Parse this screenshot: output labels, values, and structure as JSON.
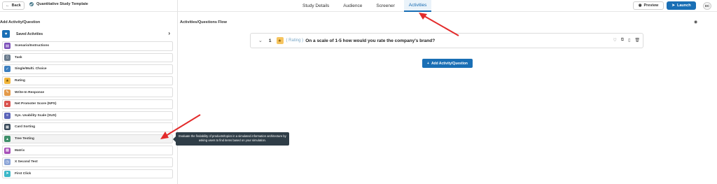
{
  "topbar": {
    "back_label": "Back",
    "project_title": "Quantitative Study Template",
    "tabs": [
      {
        "label": "Study Details",
        "active": false
      },
      {
        "label": "Audience",
        "active": false
      },
      {
        "label": "Screener",
        "active": false
      },
      {
        "label": "Activities",
        "active": true
      }
    ],
    "preview_label": "Preview",
    "launch_label": "Launch",
    "avatar_initials": "DC"
  },
  "left_panel": {
    "title": "Add Activity/Question",
    "saved_label": "Saved Activities",
    "items": [
      {
        "label": "Scenario/Instructions",
        "icon": "document-icon",
        "color": "#7b4fb8"
      },
      {
        "label": "Task",
        "icon": "clipboard-icon",
        "color": "#6a7b8c"
      },
      {
        "label": "Single/Multi. Choice",
        "icon": "checkbox-icon",
        "color": "#3d7fbf"
      },
      {
        "label": "Rating",
        "icon": "star-icon",
        "color": "#f2b63c"
      },
      {
        "label": "Write-In Response",
        "icon": "pencil-icon",
        "color": "#e39a4a"
      },
      {
        "label": "Net Promoter Score (NPS)",
        "icon": "megaphone-icon",
        "color": "#d9534f"
      },
      {
        "label": "Sys. Usability Scale (SUS)",
        "icon": "bars-icon",
        "color": "#5a63b8"
      },
      {
        "label": "Card Sorting",
        "icon": "cards-icon",
        "color": "#3a4a5a"
      },
      {
        "label": "Tree Testing",
        "icon": "tree-icon",
        "color": "#3f8f6a"
      },
      {
        "label": "Matrix",
        "icon": "grid-icon",
        "color": "#a64fb8"
      },
      {
        "label": "X Second Test",
        "icon": "timer-icon",
        "color": "#8aa3d6"
      },
      {
        "label": "First Click",
        "icon": "cursor-icon",
        "color": "#3cb8c8"
      }
    ]
  },
  "main": {
    "title": "Activities/Questions Flow",
    "question": {
      "number": "1",
      "tag": "( Rating )",
      "text": "On a scale of 1-5 how would you rate the company's brand?"
    },
    "add_button_label": "Add Activity/Question"
  },
  "tooltip": {
    "text": "Evaluate the findability of products/topics in a simulated information architecture by asking users to find items based on your simulation."
  },
  "colors": {
    "accent": "#1a6fb5",
    "annotation_arrow": "#e32b2b"
  }
}
